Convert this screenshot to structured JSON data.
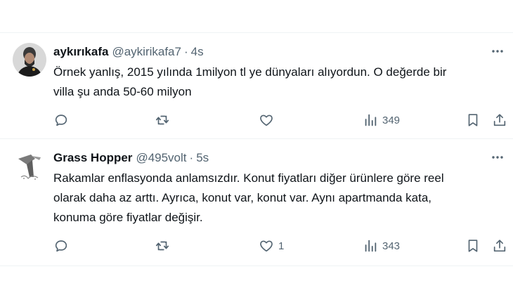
{
  "tweets": [
    {
      "display_name": "aykırıkafa",
      "handle": "@aykirikafa7",
      "separator": "·",
      "time": "4s",
      "text": "Örnek yanlış, 2015 yılında 1milyon tl ye dünyaları alıyordun. O değerde bir\nvilla şu anda 50-60 milyon",
      "actions": {
        "replies": "",
        "retweets": "",
        "likes": "",
        "views": "349"
      },
      "avatar_icon": "user-photo-avatar"
    },
    {
      "display_name": "Grass Hopper",
      "handle": "@495volt",
      "separator": "·",
      "time": "5s",
      "text": "Rakamlar enflasyonda anlamsızdır. Konut fiyatları diğer ürünlere göre reel\nolarak daha az arttı. Ayrıca, konut var, konut var. Aynı apartmanda kata,\nkonuma göre fiyatlar değişir.",
      "actions": {
        "replies": "",
        "retweets": "",
        "likes": "1",
        "views": "343"
      },
      "avatar_icon": "grasshopper-avatar"
    }
  ],
  "colors": {
    "text": "#0f1419",
    "secondary": "#536471",
    "border": "#eff3f4"
  }
}
